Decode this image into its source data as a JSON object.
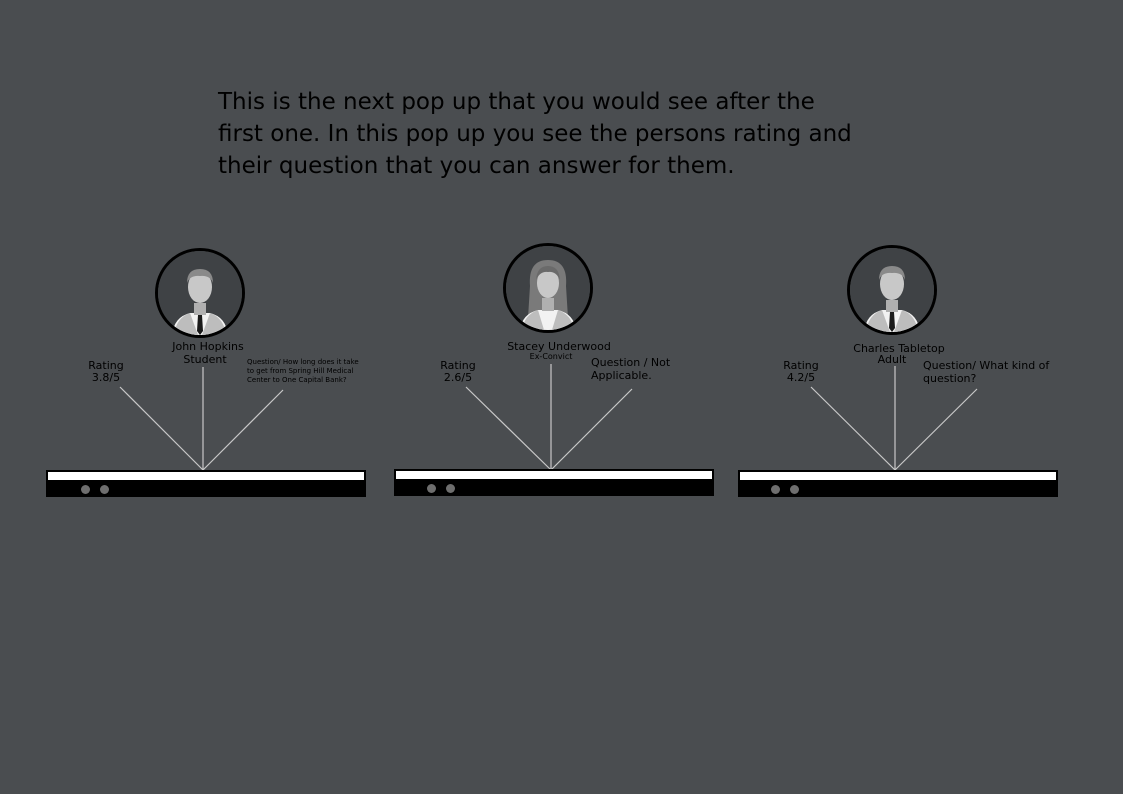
{
  "intro": {
    "line1": "This is the next pop up that you would see after the",
    "line2": "first one. In this pop up you see the persons rating and",
    "line3": "their question that you can answer for them."
  },
  "cards": [
    {
      "name": "John Hopkins",
      "role": "Student",
      "rating_label": "Rating",
      "rating_value": "3.8/5",
      "question_lines": [
        "Question/ How long does it take",
        "to get from Spring Hill Medical",
        "Center to One Capital Bank?"
      ],
      "avatar_icon": "male-avatar-icon"
    },
    {
      "name": "Stacey Underwood",
      "role": "Ex-Convict",
      "rating_label": "Rating",
      "rating_value": "2.6/5",
      "question_lines": [
        "Question / Not",
        "Applicable."
      ],
      "avatar_icon": "female-avatar-icon"
    },
    {
      "name": "Charles Tabletop",
      "role": "Adult",
      "rating_label": "Rating",
      "rating_value": "4.2/5",
      "question_lines": [
        "Question/ What kind of",
        "question?"
      ],
      "avatar_icon": "male-avatar-icon"
    }
  ],
  "colors": {
    "background": "#4a4d50",
    "avatar_bg": "#3f4245",
    "figure": "#bdbdbd",
    "shirt": "#f2f2f2",
    "lines": "#c8c8c8"
  }
}
